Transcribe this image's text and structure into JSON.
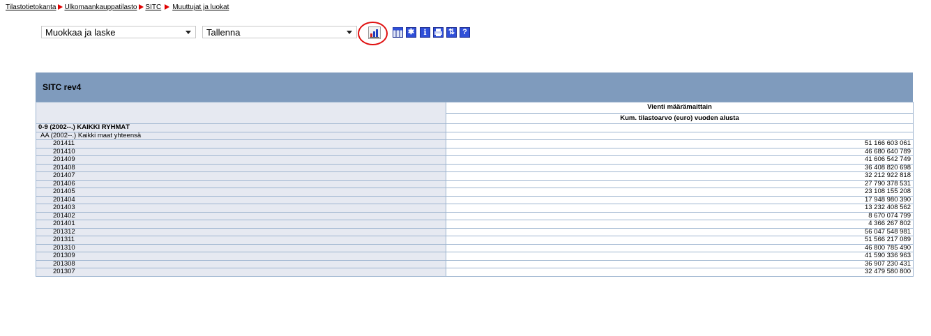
{
  "breadcrumb": {
    "items": [
      "Tilastotietokanta",
      "Ulkomaankauppatilasto",
      "SITC",
      "Muuttujat ja luokat"
    ]
  },
  "toolbar": {
    "select1_value": "Muokkaa ja laske",
    "select2_value": "Tallenna",
    "icons": [
      "bar-chart-icon",
      "table-layout-icon",
      "asterisk-icon",
      "info-icon",
      "print-icon",
      "pivot-icon",
      "help-icon"
    ],
    "info_glyph": "i",
    "pivot_glyph": "⇅",
    "help_glyph": "?",
    "asterisk_glyph": "✱",
    "highlight_color": "#e01010"
  },
  "table": {
    "title": "SITC rev4",
    "header_row1": "Vienti määrämaittain",
    "header_row2": "Kum. tilastoarvo (euro) vuoden alusta",
    "group_label": "0-9 (2002--.) KAIKKI RYHMÄT",
    "subgroup_label": "AA (2002--.) Kaikki maat yhteensä",
    "rows": [
      {
        "period": "201411",
        "value": "51 166 603 061"
      },
      {
        "period": "201410",
        "value": "46 680 640 789"
      },
      {
        "period": "201409",
        "value": "41 606 542 749"
      },
      {
        "period": "201408",
        "value": "36 408 820 698"
      },
      {
        "period": "201407",
        "value": "32 212 922 818"
      },
      {
        "period": "201406",
        "value": "27 790 378 531"
      },
      {
        "period": "201405",
        "value": "23 108 155 208"
      },
      {
        "period": "201404",
        "value": "17 948 980 390"
      },
      {
        "period": "201403",
        "value": "13 232 408 562"
      },
      {
        "period": "201402",
        "value": "8 670 074 799"
      },
      {
        "period": "201401",
        "value": "4 366 267 802"
      },
      {
        "period": "201312",
        "value": "56 047 548 981"
      },
      {
        "period": "201311",
        "value": "51 566 217 089"
      },
      {
        "period": "201310",
        "value": "46 800 785 490"
      },
      {
        "period": "201309",
        "value": "41 590 336 963"
      },
      {
        "period": "201308",
        "value": "36 907 230 431"
      },
      {
        "period": "201307",
        "value": "32 479 580 800"
      }
    ],
    "header_bg": "#7f9bbd",
    "label_bg": "#e6e9f1"
  }
}
